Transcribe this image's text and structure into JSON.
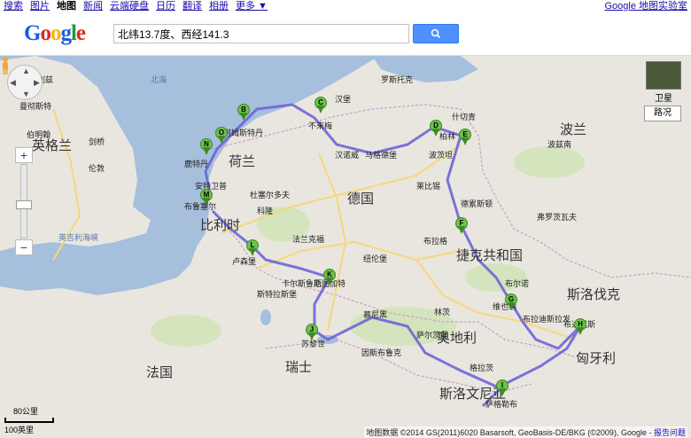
{
  "topbar": {
    "links": [
      "搜索",
      "图片",
      "地图",
      "新闻",
      "云端硬盘",
      "日历",
      "翻译",
      "相册",
      "更多 ▼"
    ],
    "active_index": 2,
    "labs": "Google 地图实验室"
  },
  "header": {
    "logo": [
      "G",
      "o",
      "o",
      "g",
      "l",
      "e"
    ],
    "search_value": "北纬13.7度、西经141.3",
    "search_icon": "magnifier-icon"
  },
  "map_controls": {
    "satellite_label": "卫星",
    "road_label": "路况",
    "zoom_in": "+",
    "zoom_out": "−",
    "zoom_level_fraction": 0.5
  },
  "scale": {
    "km": "80公里",
    "mi": "100英里"
  },
  "attribution": {
    "text": "地图数据 ©2014 GS(2011)6020 Basarsoft, GeoBasis-DE/BKG (©2009), Google -",
    "report": "报告问题"
  },
  "countries": [
    "荷兰",
    "德国",
    "比利时",
    "捷克共和国",
    "波兰",
    "奥地利",
    "匈牙利",
    "瑞士",
    "法国",
    "斯洛伐克",
    "斯洛文尼亚",
    "英格兰"
  ],
  "cities": [
    "利兹",
    "曼彻斯特",
    "伯明翰",
    "剑桥",
    "伦敦",
    "布鲁塞尔",
    "阿姆斯特丹",
    "鹿特丹",
    "安特卫普",
    "不来梅",
    "汉堡",
    "汉诺威",
    "柏林",
    "波茨坦",
    "马格德堡",
    "莱比锡",
    "德累斯顿",
    "布拉格",
    "法兰克福",
    "纽伦堡",
    "斯图加特",
    "慕尼黑",
    "苏黎世",
    "因斯布鲁克",
    "萨尔茨堡",
    "维也纳",
    "布拉迪斯拉发",
    "布达佩斯",
    "萨格勒布",
    "卢森堡",
    "斯特拉斯堡",
    "卡尔斯鲁厄",
    "波兹南",
    "弗罗茨瓦夫",
    "格拉茨",
    "林茨",
    "布尔诺",
    "什切青",
    "罗斯托克",
    "科隆",
    "杜塞尔多夫"
  ],
  "seas": [
    "英吉利海峡",
    "北海"
  ],
  "markers": [
    "A",
    "B",
    "C",
    "D",
    "E",
    "F",
    "G",
    "H",
    "I",
    "J",
    "K",
    "L",
    "M",
    "N",
    "O"
  ]
}
